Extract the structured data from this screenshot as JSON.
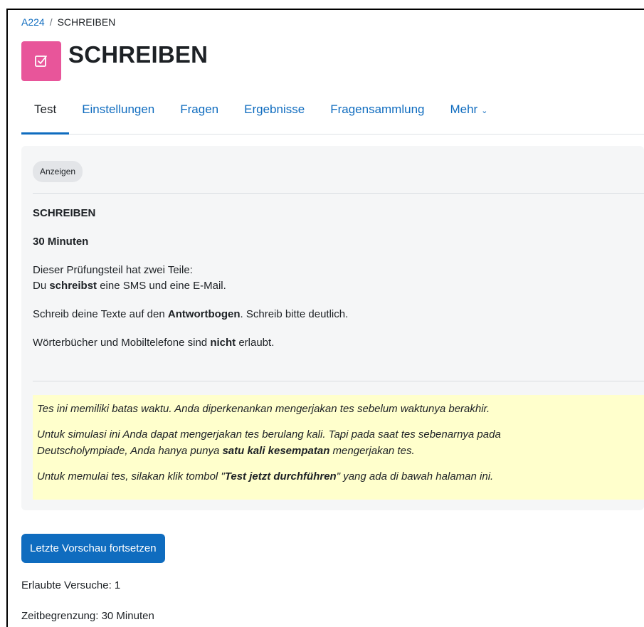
{
  "breadcrumb": {
    "parent": "A224",
    "separator": "/",
    "current": "SCHREIBEN"
  },
  "header": {
    "title": "SCHREIBEN",
    "icon": "quiz-checkbox-icon",
    "icon_color": "#e8559a"
  },
  "tabs": [
    {
      "label": "Test",
      "active": true
    },
    {
      "label": "Einstellungen"
    },
    {
      "label": "Fragen"
    },
    {
      "label": "Ergebnisse"
    },
    {
      "label": "Fragensammlung"
    },
    {
      "label": "Mehr"
    }
  ],
  "card": {
    "pill": "Anzeigen",
    "heading": "SCHREIBEN",
    "duration": "30 Minuten",
    "para1_line1": "Dieser Prüfungsteil hat zwei Teile:",
    "para1_line2_pre": "Du ",
    "para1_line2_bold": "schreibst",
    "para1_line2_post": " eine SMS und eine E-Mail.",
    "para2_pre": "Schreib deine Texte auf den ",
    "para2_bold": "Antwortbogen",
    "para2_post": ". Schreib bitte deutlich.",
    "para3_pre": "Wörterbücher und Mobiltelefone sind ",
    "para3_bold": "nicht",
    "para3_post": " erlaubt."
  },
  "notice": {
    "line1": "Tes ini memiliki batas waktu. Anda diperkenankan mengerjakan tes sebelum waktunya berakhir.",
    "line2_a": "Untuk simulasi ini Anda dapat mengerjakan tes berulang kali. Tapi pada saat tes sebenarnya pada",
    "line2_b_pre": "Deutscholympiade, Anda hanya punya ",
    "line2_b_bold": "satu kali kesempatan",
    "line2_b_post": " mengerjakan tes.",
    "line3_pre": "Untuk memulai tes, silakan klik tombol \"",
    "line3_bold": "Test jetzt durchführen",
    "line3_post": "\" yang ada di bawah halaman ini.",
    "background": "#ffffcc"
  },
  "actions": {
    "continue_preview": "Letzte Vorschau fortsetzen",
    "primary_color": "#0f6cbf"
  },
  "info": {
    "attempts": "Erlaubte Versuche: 1",
    "time_limit": "Zeitbegrenzung: 30 Minuten"
  }
}
